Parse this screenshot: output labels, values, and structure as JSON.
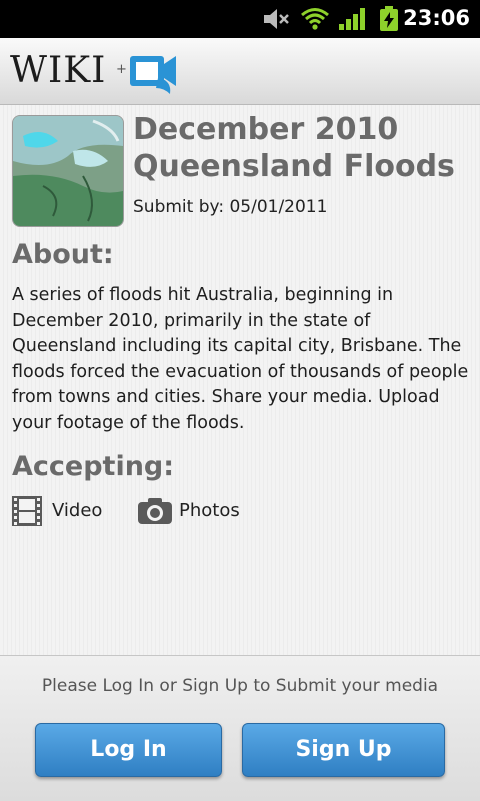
{
  "status_bar": {
    "time": "23:06",
    "icons": [
      "mute-icon",
      "wifi-icon",
      "signal-icon",
      "battery-charging-icon"
    ]
  },
  "header": {
    "logo_text": "WIKI",
    "logo_plus": "+"
  },
  "event": {
    "title": "December 2010 Queensland Floods",
    "submit_line": "Submit by: 05/01/2011",
    "about_heading": "About:",
    "about_text": "A series of floods hit Australia, beginning in December 2010, primarily in the state of Queensland including its capital city, Brisbane. The floods forced the evacuation of thousands of people from towns and cities. Share your media. Upload your footage of the floods.",
    "accepting_heading": "Accepting:",
    "accepting": [
      {
        "label": "Video",
        "icon": "film-icon"
      },
      {
        "label": "Photos",
        "icon": "camera-icon"
      }
    ]
  },
  "footer": {
    "prompt": "Please Log In or Sign Up to Submit your media",
    "login_label": "Log In",
    "signup_label": "Sign Up"
  },
  "colors": {
    "accent_button": "#3a8bd0",
    "heading_gray": "#6a6a6a",
    "status_green": "#8ed12b"
  }
}
